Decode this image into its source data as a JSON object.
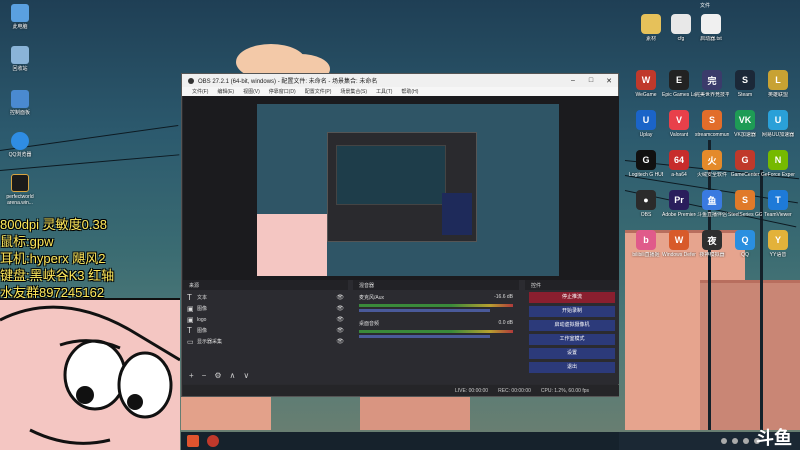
{
  "overlay": {
    "lines": [
      "800dpi 灵敏度0.38",
      "鼠标:gpw",
      "耳机:hyperx 飓风2",
      "键盘:黑峡谷K3 红轴",
      "水友群897245162"
    ]
  },
  "left_icons": [
    {
      "label": "此电脑",
      "color": "#5aa0e0"
    },
    {
      "label": "回收站",
      "color": "#8ab4d8"
    },
    {
      "label": "控制面板",
      "color": "#4a8ad0"
    },
    {
      "label": "QQ浏览器",
      "color": "#2f8de4"
    },
    {
      "label": "perfectworld arena.win...",
      "color": "#1b1b1b"
    }
  ],
  "right_top_icons": [
    {
      "label": "文件",
      "color": "#d8d8d8"
    },
    {
      "label": "素材",
      "color": "#e6c15a"
    },
    {
      "label": "cfg",
      "color": "#e8e8e8"
    },
    {
      "label": "启动器.txt",
      "color": "#f0f0f0"
    }
  ],
  "right_icons": [
    {
      "label": "WeGame",
      "color": "#c0392b",
      "glyph": "W"
    },
    {
      "label": "Epic Games Launcher",
      "color": "#222",
      "glyph": "E"
    },
    {
      "label": "完美世界竞技平台",
      "color": "#3b3b6b",
      "glyph": "完"
    },
    {
      "label": "Steam",
      "color": "#1b2838",
      "glyph": "S"
    },
    {
      "label": "英雄联盟",
      "color": "#c8a233",
      "glyph": "L"
    },
    {
      "label": "Uplay",
      "color": "#1b64c8",
      "glyph": "U"
    },
    {
      "label": "Valorant",
      "color": "#e8404a",
      "glyph": "V"
    },
    {
      "label": "streamcommunity",
      "color": "#e26d2a",
      "glyph": "S"
    },
    {
      "label": "VK加速器",
      "color": "#1e9b55",
      "glyph": "VK"
    },
    {
      "label": "网易UU加速器",
      "color": "#2aa0d8",
      "glyph": "U"
    },
    {
      "label": "Logitech G HUB",
      "color": "#111",
      "glyph": "G"
    },
    {
      "label": "a-ha64",
      "color": "#c72c2c",
      "glyph": "64"
    },
    {
      "label": "火绒安全软件",
      "color": "#e48a2a",
      "glyph": "火"
    },
    {
      "label": "GameCenter",
      "color": "#c0392b",
      "glyph": "G"
    },
    {
      "label": "GeForce Experience",
      "color": "#76b900",
      "glyph": "N"
    },
    {
      "label": "OBS",
      "color": "#2b2b2b",
      "glyph": "●"
    },
    {
      "label": "Adobe Premiere Pro",
      "color": "#2a1e5c",
      "glyph": "Pr"
    },
    {
      "label": "斗鱼直播伴侣",
      "color": "#3a7ae0",
      "glyph": "鱼"
    },
    {
      "label": "SteelSeries GG",
      "color": "#e07a2a",
      "glyph": "S"
    },
    {
      "label": "TeamViewer",
      "color": "#1e7ad8",
      "glyph": "T"
    },
    {
      "label": "bilibili直播姬",
      "color": "#e05a8a",
      "glyph": "b"
    },
    {
      "label": "Windows Defender",
      "color": "#d85a2a",
      "glyph": "W"
    },
    {
      "label": "夜神模拟器",
      "color": "#2f2f2f",
      "glyph": "夜"
    },
    {
      "label": "QQ",
      "color": "#2a8fe0",
      "glyph": "Q"
    },
    {
      "label": "YY语音",
      "color": "#e3b23a",
      "glyph": "Y"
    }
  ],
  "obs": {
    "title": "OBS 27.2.1 (64-bit, windows) - 配置文件: 未命名 - 场景集合: 未命名",
    "menu": [
      "文件(F)",
      "编辑(E)",
      "视图(V)",
      "停靠窗口(D)",
      "配置文件(P)",
      "场景集合(S)",
      "工具(T)",
      "帮助(H)"
    ],
    "docks": {
      "sources_header": "来源",
      "mixer_header": "混音器",
      "controls_header": "控件"
    },
    "sources": [
      "文本",
      "图像",
      "logo",
      "图像",
      "显示器采集"
    ],
    "mixer": [
      {
        "name": "麦克风/Aux",
        "db": "-16.6 dB"
      },
      {
        "name": "桌面音频",
        "db": "0.0 dB"
      }
    ],
    "controls": [
      "停止推流",
      "开始录制",
      "启动虚拟摄像机",
      "工作室模式",
      "设置",
      "退出"
    ],
    "status": {
      "live": "LIVE: 00:00:00",
      "rec": "REC: 00:00:00",
      "cpu": "CPU: 1.2%, 60.00 fps"
    }
  },
  "watermark": "斗鱼"
}
